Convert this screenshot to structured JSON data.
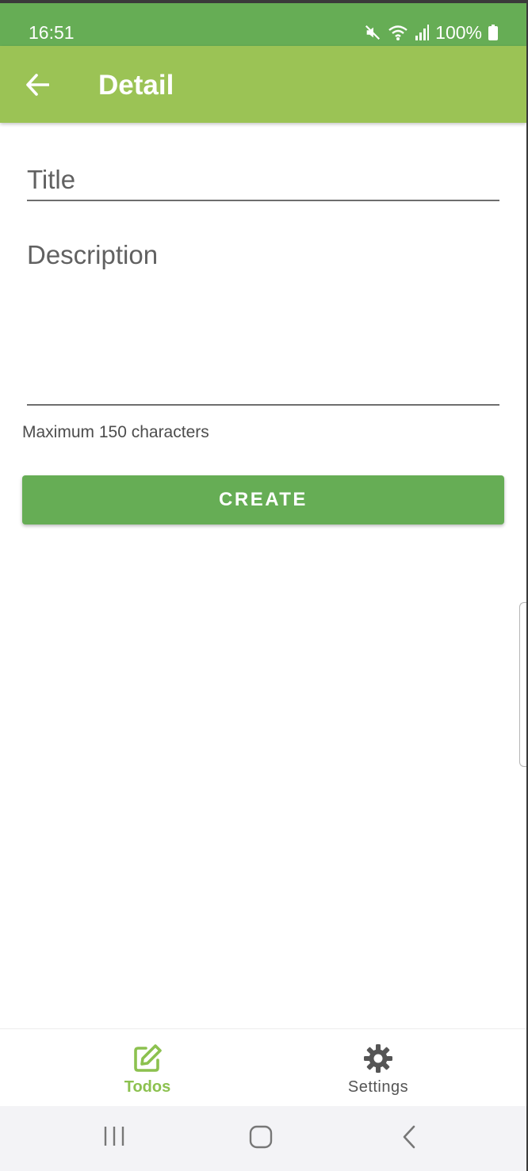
{
  "status_bar": {
    "time": "16:51",
    "battery": "100%"
  },
  "app_bar": {
    "title": "Detail"
  },
  "form": {
    "title_placeholder": "Title",
    "description_placeholder": "Description",
    "helper_text": "Maximum 150 characters",
    "create_label": "CREATE"
  },
  "bottom_nav": {
    "items": [
      {
        "label": "Todos",
        "icon": "edit-square-icon",
        "active": true
      },
      {
        "label": "Settings",
        "icon": "gear-icon",
        "active": false
      }
    ]
  },
  "system_nav": [
    "recents-icon",
    "home-icon",
    "back-icon"
  ],
  "colors": {
    "status_bar": "#66ad55",
    "app_bar": "#9bc355",
    "primary_button": "#66ad55",
    "active_nav": "#8cc14f"
  }
}
